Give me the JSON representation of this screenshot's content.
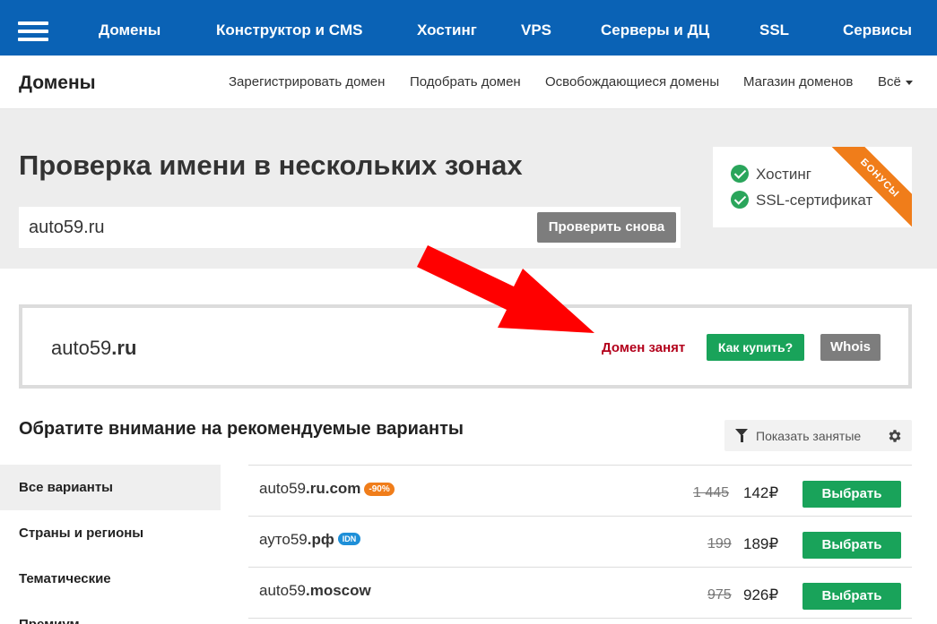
{
  "topnav": {
    "items": [
      "Домены",
      "Конструктор и CMS",
      "Хостинг",
      "VPS",
      "Серверы и ДЦ",
      "SSL",
      "Сервисы"
    ]
  },
  "subnav": {
    "section": "Домены",
    "items": [
      "Зарегистрировать домен",
      "Подобрать домен",
      "Освобождающиеся домены",
      "Магазин доменов",
      "Всё"
    ]
  },
  "hero": {
    "title": "Проверка имени в нескольких зонах",
    "search_value": "auto59.ru",
    "check_button": "Проверить снова"
  },
  "bonus": {
    "items": [
      "Хостинг",
      "SSL-сертификат"
    ],
    "ribbon": "БОНУСЫ"
  },
  "result": {
    "name": "auto59",
    "zone": ".ru",
    "status": "Домен занят",
    "howbuy_button": "Как купить?",
    "whois_button": "Whois"
  },
  "recommend": {
    "title": "Обратите внимание на рекомендуемые варианты",
    "show_busy": "Показать занятые"
  },
  "sidebar": {
    "items": [
      "Все варианты",
      "Страны и регионы",
      "Тематические",
      "Премиум"
    ]
  },
  "domains": [
    {
      "name": "auto59",
      "zone": ".ru.com",
      "badge": "-90%",
      "badge_type": "sale",
      "old_price": "1 445",
      "price": "142₽",
      "button": "Выбрать"
    },
    {
      "name": "ауто59",
      "zone": ".рф",
      "badge": "IDN",
      "badge_type": "idn",
      "old_price": "199",
      "price": "189₽",
      "button": "Выбрать"
    },
    {
      "name": "auto59",
      "zone": ".moscow",
      "badge": "",
      "badge_type": "",
      "old_price": "975",
      "price": "926₽",
      "button": "Выбрать"
    }
  ],
  "colors": {
    "nav_blue": "#0a62b5",
    "green": "#19a35a",
    "busy_red": "#b3001b",
    "orange": "#f07d1a",
    "arrow": "#ff0000"
  }
}
